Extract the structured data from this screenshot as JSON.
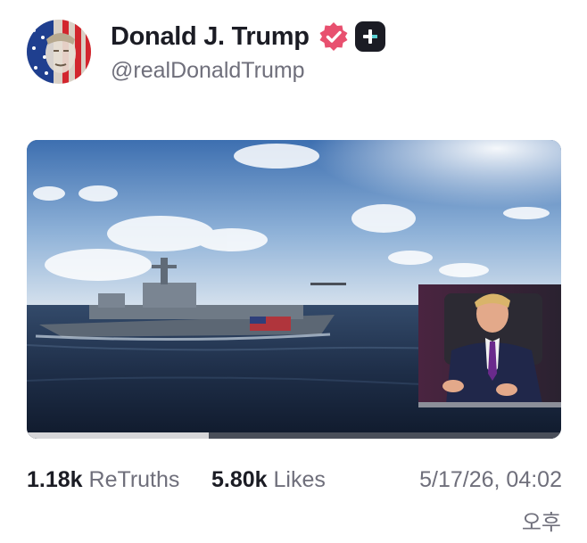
{
  "post": {
    "author_name": "Donald J. Trump",
    "author_handle": "@realDonaldTrump",
    "verified_color": "#e8506f",
    "media": {
      "type": "video",
      "progress": 0.34
    },
    "stats": {
      "retruths_count": "1.18k",
      "retruths_label": "ReTruths",
      "likes_count": "5.80k",
      "likes_label": "Likes"
    },
    "date": "5/17/26, 04:02",
    "ampm": "오후"
  }
}
